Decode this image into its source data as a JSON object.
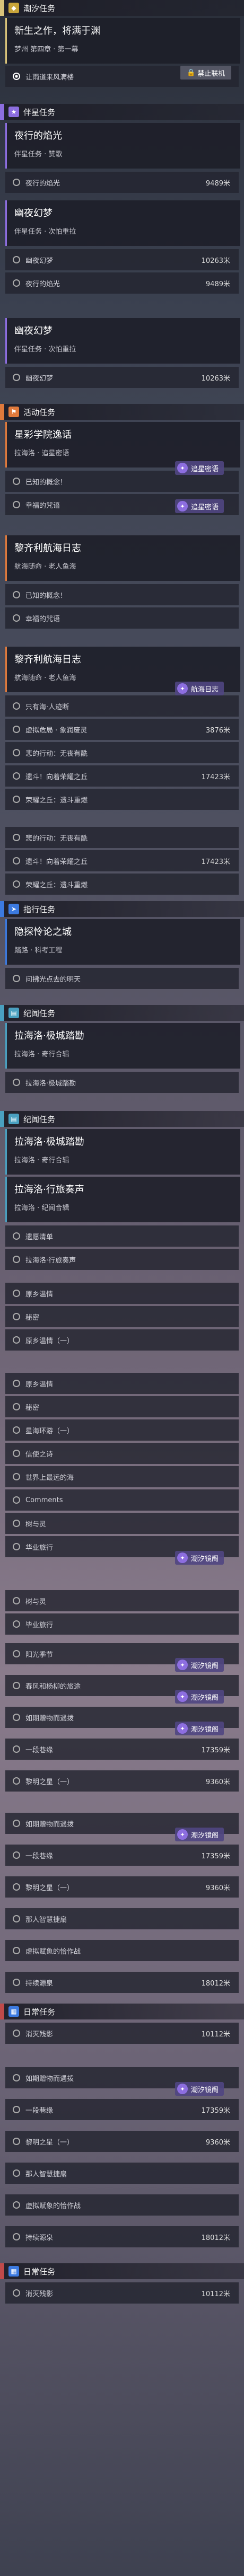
{
  "sections": {
    "chaoxi": "潮汐任务",
    "banxing": "伴星任务",
    "huodong": "活动任务",
    "zhixing": "指行任务",
    "jiwen": "纪闻任务",
    "richang": "日常任务"
  },
  "card1": {
    "title": "新生之作，将满于渊",
    "sub": "梦州 第四章 · 第一幕"
  },
  "card1_row": "让雨道来风满楼",
  "btn_forbid": "禁止联机",
  "card2": {
    "title": "夜行的焰光",
    "sub": "伴星任务 · 赞歌"
  },
  "card2_row": {
    "label": "夜行的焰光",
    "value": "9489米"
  },
  "card3": {
    "title": "幽夜幻梦",
    "sub": "伴星任务 · 次怕重拉"
  },
  "card3_rows": [
    {
      "label": "幽夜幻梦",
      "value": "10263米"
    },
    {
      "label": "夜行的焰光",
      "value": "9489米"
    }
  ],
  "card4": {
    "title": "幽夜幻梦",
    "sub": "伴星任务 · 次怕重拉"
  },
  "card4_row": {
    "label": "幽夜幻梦",
    "value": "10263米"
  },
  "card5": {
    "title": "星彩学院逸话",
    "sub": "拉海洛 · 追星密语"
  },
  "card5_rows": [
    "已知的概念！",
    "幸福的咒语"
  ],
  "badges": {
    "zhuixing": "追星密语",
    "hangri": "航海日志",
    "chaoxi": "潮汐镜阁"
  },
  "card6": {
    "title": "黎齐利航海日志",
    "sub": "航海随命 · 老人鱼海"
  },
  "card6_rows": [
    "已知的概念！",
    "幸福的咒语"
  ],
  "card7": {
    "title": "黎齐利航海日志",
    "sub": "航海随命 · 老人鱼海"
  },
  "card7_rows": [
    {
      "label": "只有海·人迹断",
      "value": ""
    },
    {
      "label": "虚拟危局 · 象润废灵",
      "value": "3876米"
    },
    {
      "label": "悲的行动：无丧有酰",
      "value": ""
    },
    {
      "label": "遗斗！向着荣耀之丘",
      "value": "17423米"
    },
    {
      "label": "荣耀之丘：遗斗重燃",
      "value": ""
    }
  ],
  "card7_rows2": [
    {
      "label": "悲的行动：无丧有酰",
      "value": ""
    },
    {
      "label": "遗斗！向着荣耀之丘",
      "value": "17423米"
    },
    {
      "label": "荣耀之丘：遗斗重燃",
      "value": ""
    }
  ],
  "card8": {
    "title": "隐探怜论之城",
    "sub": "踏路 · 科考工程"
  },
  "card8_row": "问拂光点去的明天",
  "card9": {
    "title": "拉海洛·极城踏勘",
    "sub": "拉海洛 · 奇行合辑"
  },
  "card9_row": "拉海洛·极城踏勘",
  "card10": {
    "title": "拉海洛·极城踏勘",
    "sub": "拉海洛 · 奇行合辑"
  },
  "card11": {
    "title": "拉海洛·行旅奏声",
    "sub": "拉海洛 · 纪闻合辑"
  },
  "card11_rows": [
    "遗愿清单",
    "拉海洛·行旅奏声"
  ],
  "list1": [
    "原乡温情",
    "秘密",
    "原乡温情（一）"
  ],
  "list2": [
    "原乡温情",
    "秘密",
    "星海环游（一）",
    "信使之诗",
    "世界上最远的海",
    "Comments",
    "树与灵",
    "华业旅行"
  ],
  "list3": [
    {
      "label": "树与灵",
      "value": ""
    },
    {
      "label": "毕业旅行",
      "value": ""
    },
    {
      "label": "阳光季节",
      "value": ""
    },
    {
      "label": "春风和杨柳的旅途",
      "value": ""
    },
    {
      "label": "如期赠物而遇拨",
      "value": ""
    },
    {
      "label": "一段巷缘",
      "value": "17359米"
    },
    {
      "label": "黎明之星（一）",
      "value": "9360米"
    },
    {
      "label": "",
      "value": ""
    }
  ],
  "list4": [
    {
      "label": "如期赠物而遇拨",
      "value": ""
    },
    {
      "label": "一段巷缘",
      "value": "17359米"
    },
    {
      "label": "黎明之星（一）",
      "value": "9360米"
    },
    {
      "label": "那人智慧捷扇",
      "value": ""
    },
    {
      "label": "虚拟赋象的恰作战",
      "value": ""
    },
    {
      "label": "持续源泉",
      "value": "18012米"
    }
  ],
  "daily1": {
    "label": "消灭残影",
    "value": "10112米"
  },
  "list5": [
    {
      "label": "如期赠物而遇拨",
      "value": ""
    },
    {
      "label": "一段巷缘",
      "value": "17359米"
    },
    {
      "label": "黎明之星（一）",
      "value": "9360米"
    },
    {
      "label": "那人智慧捷扇",
      "value": ""
    },
    {
      "label": "虚拟赋象的恰作战",
      "value": ""
    },
    {
      "label": "持续源泉",
      "value": "18012米"
    }
  ],
  "daily2": {
    "label": "消灭残影",
    "value": "10112米"
  },
  "colors": {
    "accent": "#d9c37a",
    "purple": "#8d6ee0",
    "orange": "#e07a3c",
    "blue": "#3c7ae0",
    "red": "#c04a4a"
  }
}
